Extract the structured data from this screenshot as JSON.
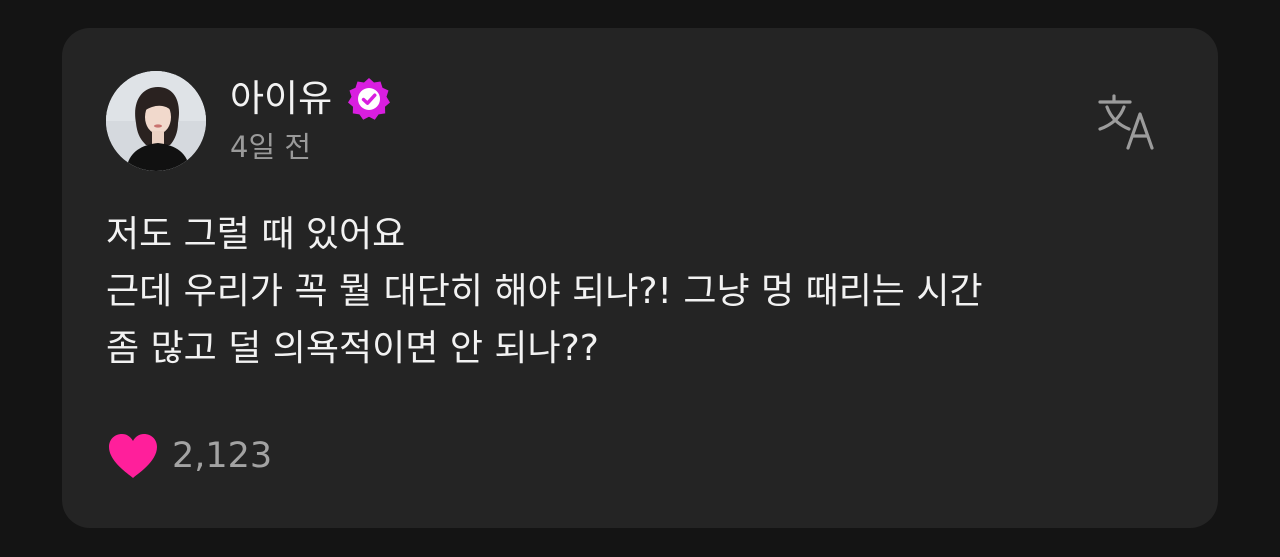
{
  "post": {
    "author_name": "아이유",
    "time": "4일 전",
    "body_lines": [
      "저도 그럴 때 있어요",
      "근데 우리가 꼭 뭘 대단히 해야 되나?! 그냥 멍 때리는 시간",
      "좀 많고 덜 의욕적이면 안 되나??"
    ],
    "like_count": "2,123",
    "liked": true
  },
  "icons": {
    "verified": "verified-badge-icon",
    "translate": "translate-icon",
    "like": "heart-icon"
  },
  "colors": {
    "background": "#141414",
    "card": "#242424",
    "verified_badge": "#d91ee0",
    "heart": "#ff1f9b",
    "text_primary": "#f2f2f2",
    "text_secondary": "#9a9a9a"
  }
}
